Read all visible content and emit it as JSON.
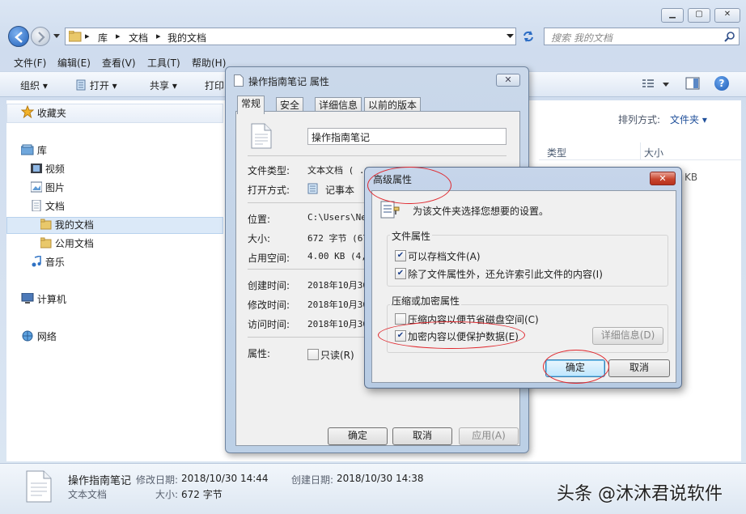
{
  "explorer": {
    "breadcrumb": [
      "库",
      "文档",
      "我的文档"
    ],
    "search_placeholder": "搜索 我的文档",
    "menu": [
      "文件(F)",
      "编辑(E)",
      "查看(V)",
      "工具(T)",
      "帮助(H)"
    ],
    "toolbar": {
      "organize": "组织",
      "open": "打开",
      "share": "共享",
      "print": "打印"
    },
    "nav": {
      "favorites": "收藏夹",
      "libraries": "库",
      "videos": "视频",
      "pictures": "图片",
      "documents": "文档",
      "my_documents": "我的文档",
      "public_documents": "公用文档",
      "music": "音乐",
      "computer": "计算机",
      "network": "网络"
    },
    "content": {
      "arrange_label": "排列方式:",
      "arrange_value": "文件夹",
      "col_type": "类型",
      "col_size": "大小",
      "size_fragment": "KB"
    },
    "details": {
      "filename": "操作指南笔记",
      "modified_label": "修改日期:",
      "modified": "2018/10/30 14:44",
      "created_label": "创建日期:",
      "created": "2018/10/30 14:38",
      "type": "文本文档",
      "size_label": "大小:",
      "size": "672 字节"
    },
    "watermark": "头条 @沐沐君说软件"
  },
  "properties": {
    "title": "操作指南笔记 属性",
    "tabs": [
      "常规",
      "安全",
      "详细信息",
      "以前的版本"
    ],
    "name_value": "操作指南笔记",
    "rows": [
      {
        "label": "文件类型:",
        "value": "文本文档 ( .t"
      },
      {
        "label": "打开方式:",
        "value": "记事本"
      },
      {
        "label": "位置:",
        "value": "C:\\Users\\Net"
      },
      {
        "label": "大小:",
        "value": "672 字节 (67"
      },
      {
        "label": "占用空间:",
        "value": "4.00 KB (4,0"
      },
      {
        "label": "创建时间:",
        "value": "2018年10月30"
      },
      {
        "label": "修改时间:",
        "value": "2018年10月30"
      },
      {
        "label": "访问时间:",
        "value": "2018年10月30"
      }
    ],
    "attr_label": "属性:",
    "readonly_label": "只读(R)",
    "ok": "确定",
    "cancel": "取消",
    "apply": "应用(A)"
  },
  "advanced": {
    "title": "高级属性",
    "description": "为该文件夹选择您想要的设置。",
    "file_attr_group": "文件属性",
    "archive_label": "可以存档文件(A)",
    "index_label": "除了文件属性外，还允许索引此文件的内容(I)",
    "compress_group": "压缩或加密属性",
    "compress_label": "压缩内容以便节省磁盘空间(C)",
    "encrypt_label": "加密内容以便保护数据(E)",
    "details_btn": "详细信息(D)",
    "ok": "确定",
    "cancel": "取消",
    "states": {
      "archive": true,
      "index": true,
      "compress": false,
      "encrypt": true
    }
  },
  "colors": {
    "highlight": "#e0282e",
    "selection": "#dbe9f8",
    "accent": "#1b3f8a"
  }
}
